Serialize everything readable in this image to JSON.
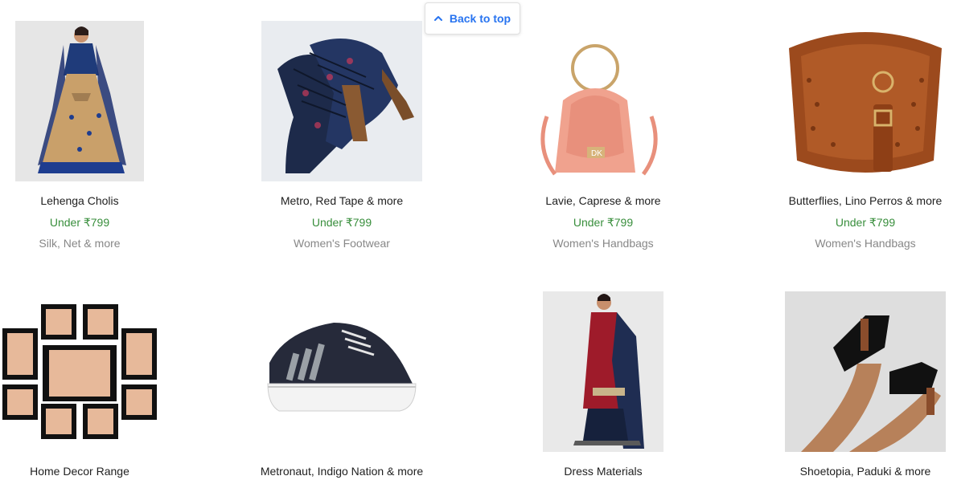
{
  "back_to_top": {
    "label": "Back to top",
    "icon": "chevron-up-icon"
  },
  "products": [
    {
      "title": "Lehenga Cholis",
      "price": "Under ₹799",
      "subtitle": "Silk, Net & more",
      "image": "lehenga-choli-image"
    },
    {
      "title": "Metro, Red Tape & more",
      "price": "Under ₹799",
      "subtitle": "Women's Footwear",
      "image": "heeled-sandals-image"
    },
    {
      "title": "Lavie, Caprese & more",
      "price": "Under ₹799",
      "subtitle": "Women's Handbags",
      "image": "pink-handbag-image"
    },
    {
      "title": "Butterflies, Lino Perros & more",
      "price": "Under ₹799",
      "subtitle": "Women's Handbags",
      "image": "brown-sling-bag-image"
    },
    {
      "title": "Home Decor Range",
      "image": "photo-frames-image"
    },
    {
      "title": "Metronaut, Indigo Nation & more",
      "image": "sneaker-image"
    },
    {
      "title": "Dress Materials",
      "image": "dress-material-image"
    },
    {
      "title": "Shoetopia, Paduki & more",
      "image": "ankle-boots-image"
    }
  ],
  "colors": {
    "accent": "#2874f0",
    "price": "#388e3c",
    "muted": "#878787",
    "text": "#212121"
  }
}
